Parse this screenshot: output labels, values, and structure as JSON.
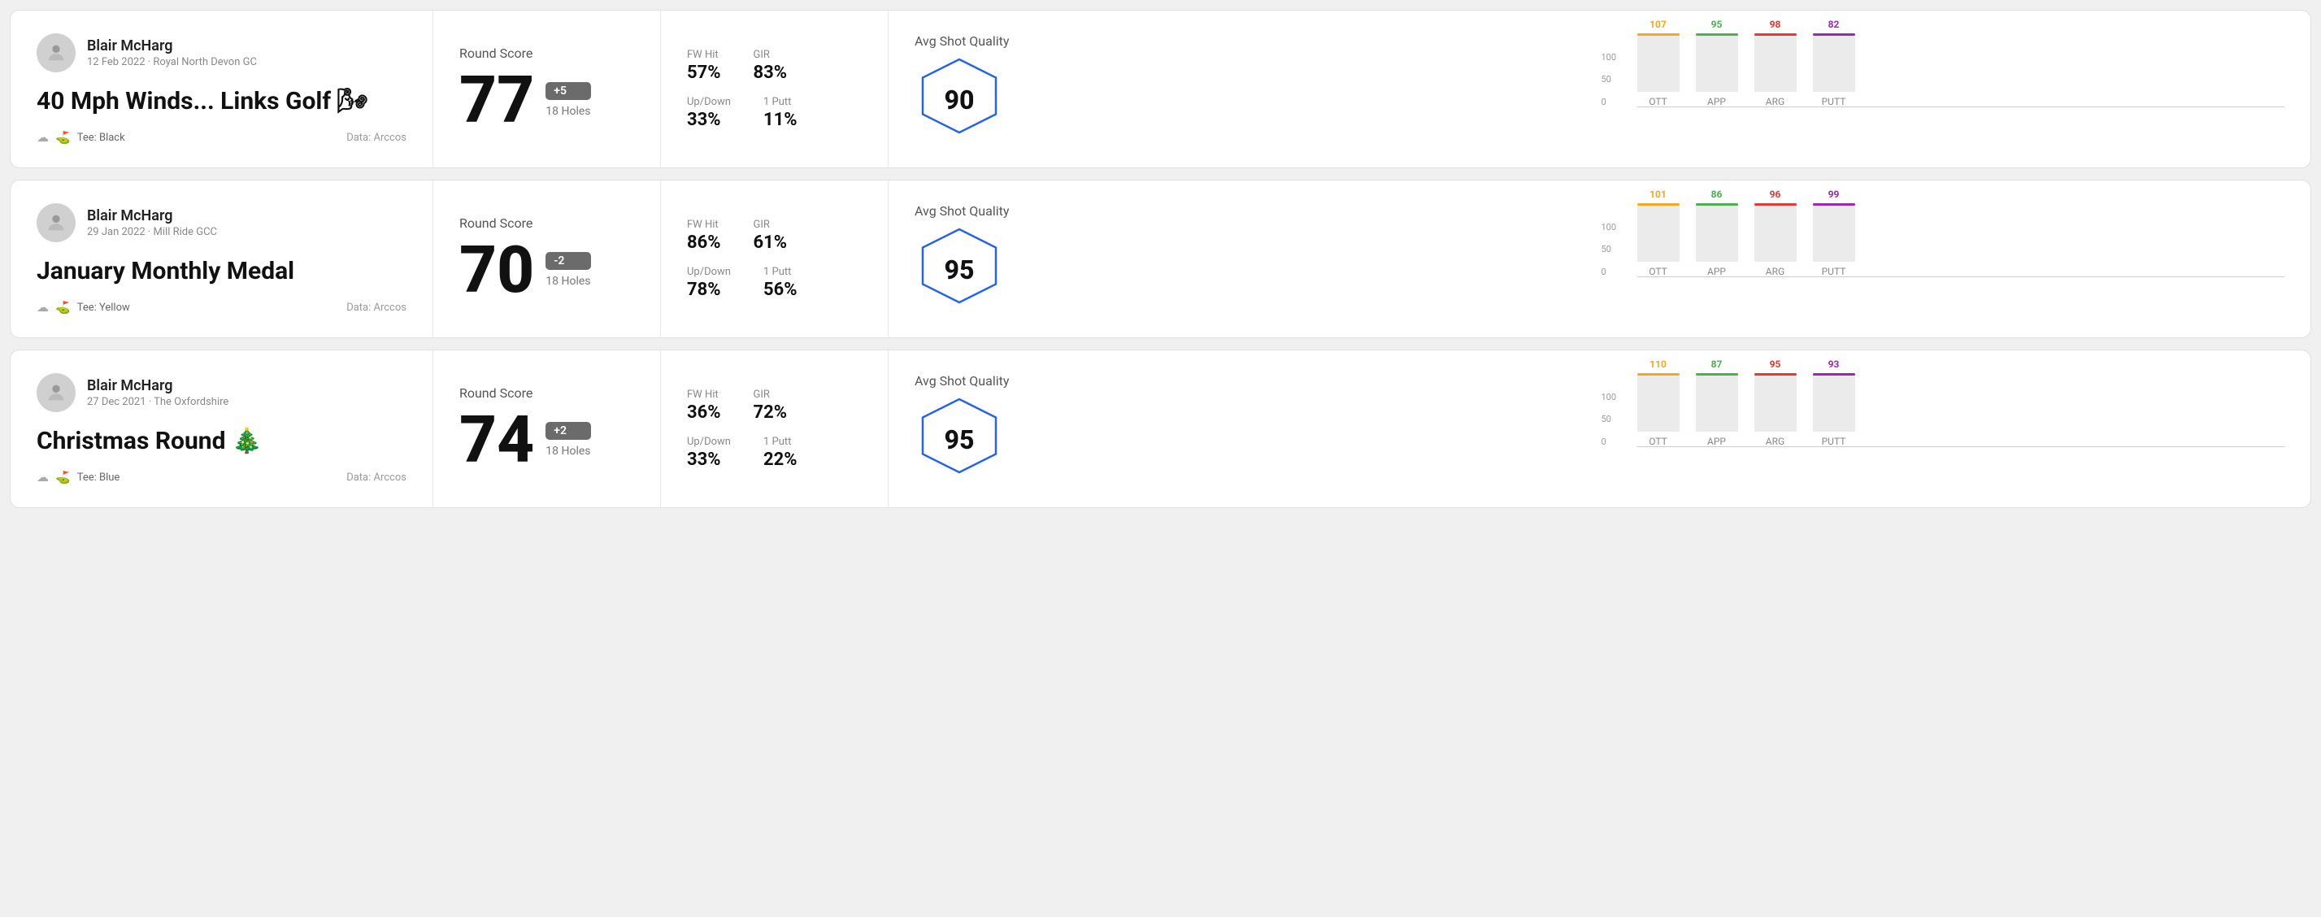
{
  "rounds": [
    {
      "id": "round1",
      "player_name": "Blair McHarg",
      "date_course": "12 Feb 2022 · Royal North Devon GC",
      "title": "40 Mph Winds... Links Golf 🌬",
      "tee": "Tee: Black",
      "data_source": "Data: Arccos",
      "score": "77",
      "score_diff": "+5",
      "holes": "18 Holes",
      "fw_hit": "57%",
      "gir": "83%",
      "up_down": "33%",
      "one_putt": "11%",
      "avg_quality": "90",
      "chart": {
        "ott": {
          "value": 107,
          "height_pct": 78,
          "color": "ott"
        },
        "app": {
          "value": 95,
          "height_pct": 68,
          "color": "app"
        },
        "arg": {
          "value": 98,
          "height_pct": 72,
          "color": "arg"
        },
        "putt": {
          "value": 82,
          "height_pct": 58,
          "color": "putt"
        }
      }
    },
    {
      "id": "round2",
      "player_name": "Blair McHarg",
      "date_course": "29 Jan 2022 · Mill Ride GCC",
      "title": "January Monthly Medal",
      "tee": "Tee: Yellow",
      "data_source": "Data: Arccos",
      "score": "70",
      "score_diff": "-2",
      "holes": "18 Holes",
      "fw_hit": "86%",
      "gir": "61%",
      "up_down": "78%",
      "one_putt": "56%",
      "avg_quality": "95",
      "chart": {
        "ott": {
          "value": 101,
          "height_pct": 74,
          "color": "ott"
        },
        "app": {
          "value": 86,
          "height_pct": 62,
          "color": "app"
        },
        "arg": {
          "value": 96,
          "height_pct": 70,
          "color": "arg"
        },
        "putt": {
          "value": 99,
          "height_pct": 72,
          "color": "putt"
        }
      }
    },
    {
      "id": "round3",
      "player_name": "Blair McHarg",
      "date_course": "27 Dec 2021 · The Oxfordshire",
      "title": "Christmas Round 🎄",
      "tee": "Tee: Blue",
      "data_source": "Data: Arccos",
      "score": "74",
      "score_diff": "+2",
      "holes": "18 Holes",
      "fw_hit": "36%",
      "gir": "72%",
      "up_down": "33%",
      "one_putt": "22%",
      "avg_quality": "95",
      "chart": {
        "ott": {
          "value": 110,
          "height_pct": 80,
          "color": "ott"
        },
        "app": {
          "value": 87,
          "height_pct": 63,
          "color": "app"
        },
        "arg": {
          "value": 95,
          "height_pct": 69,
          "color": "arg"
        },
        "putt": {
          "value": 93,
          "height_pct": 67,
          "color": "putt"
        }
      }
    }
  ],
  "labels": {
    "round_score": "Round Score",
    "fw_hit": "FW Hit",
    "gir": "GIR",
    "up_down": "Up/Down",
    "one_putt": "1 Putt",
    "avg_shot_quality": "Avg Shot Quality",
    "data_arccos": "Data: Arccos",
    "ott": "OTT",
    "app": "APP",
    "arg": "ARG",
    "putt": "PUTT",
    "y100": "100",
    "y50": "50",
    "y0": "0"
  }
}
